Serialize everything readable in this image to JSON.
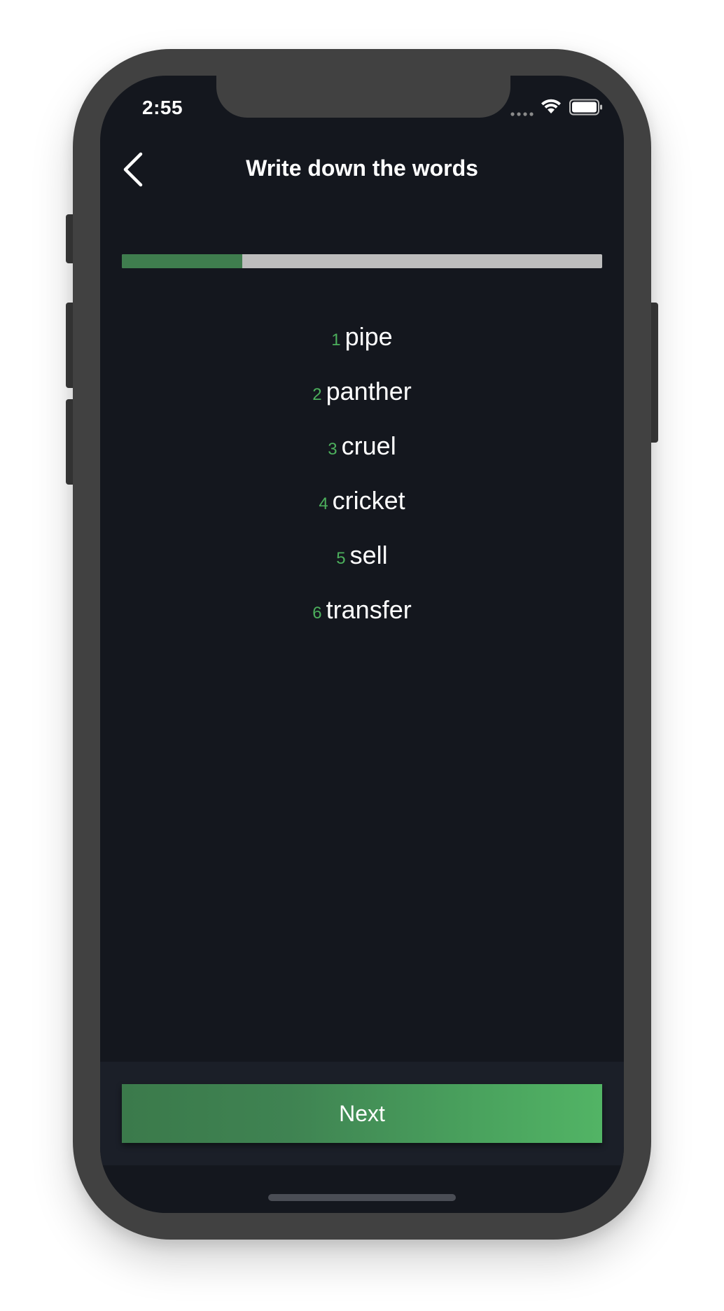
{
  "status_bar": {
    "time": "2:55",
    "icons": [
      "cellular-signal-icon",
      "wifi-icon",
      "battery-icon"
    ]
  },
  "nav": {
    "back_icon": "chevron-left-icon",
    "title": "Write down the words"
  },
  "progress": {
    "fraction": 0.25
  },
  "words": [
    {
      "number": "1",
      "word": "pipe"
    },
    {
      "number": "2",
      "word": "panther"
    },
    {
      "number": "3",
      "word": "cruel"
    },
    {
      "number": "4",
      "word": "cricket"
    },
    {
      "number": "5",
      "word": "sell"
    },
    {
      "number": "6",
      "word": "transfer"
    }
  ],
  "footer": {
    "next_label": "Next"
  },
  "colors": {
    "background": "#14171e",
    "accent_green": "#4caf5c",
    "progress_fill": "#3f7d4e",
    "progress_track": "#bdbdbd",
    "bottom_bar": "#1b1f28"
  }
}
